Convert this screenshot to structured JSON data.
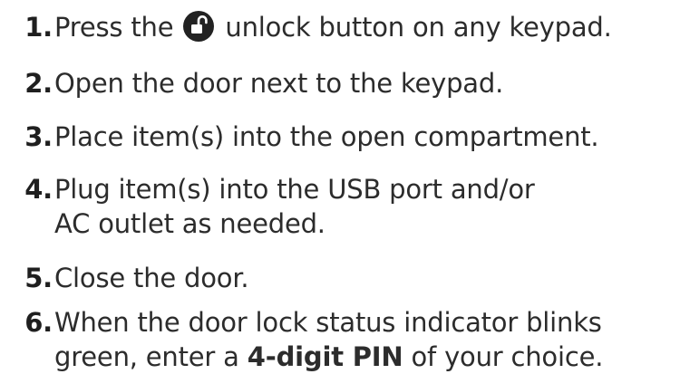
{
  "steps": [
    {
      "number": "1.",
      "before_icon": "Press the",
      "icon": "unlock-icon",
      "after_icon": "unlock button on any keypad."
    },
    {
      "number": "2.",
      "text": "Open the door next to the keypad."
    },
    {
      "number": "3.",
      "text": "Place item(s) into the open compartment."
    },
    {
      "number": "4.",
      "line1": "Plug item(s) into the USB port and/or",
      "line2": "AC outlet as needed."
    },
    {
      "number": "5.",
      "text": "Close the door."
    },
    {
      "number": "6.",
      "line1": "When the door lock status indicator blinks",
      "line2_pre": "green, enter a",
      "line2_bold": "4-digit PIN",
      "line2_post": "of your choice."
    }
  ]
}
